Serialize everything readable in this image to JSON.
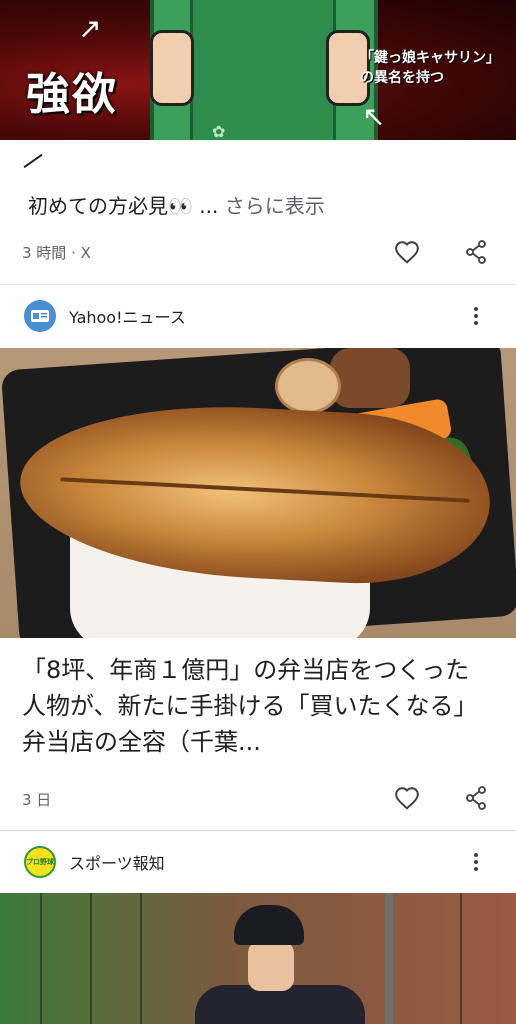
{
  "card1": {
    "snippet_text": "初めての方必見👀 ...",
    "more_label": "さらに表示",
    "meta": "3 時間 · X",
    "image": {
      "title_overlay": "強欲",
      "caption_overlay": "「鍵っ娘キャサリン」の異名を持つ"
    }
  },
  "card2": {
    "source_name": "Yahoo!ニュース",
    "headline": "「8坪、年商１億円」の弁当店をつくった人物が、新たに手掛ける「買いたくなる」弁当店の全容（千葉...",
    "meta": "3 日"
  },
  "card3": {
    "source_name": "スポーツ報知",
    "logo_text": "プロ野球"
  },
  "icons": {
    "like": "heart-outline-icon",
    "share": "share-icon",
    "more": "kebab-menu-icon"
  },
  "colors": {
    "text_primary": "#202124",
    "text_secondary": "#5f6368",
    "divider": "#dadce0",
    "yahoo_logo_bg": "#4a8fd6"
  }
}
